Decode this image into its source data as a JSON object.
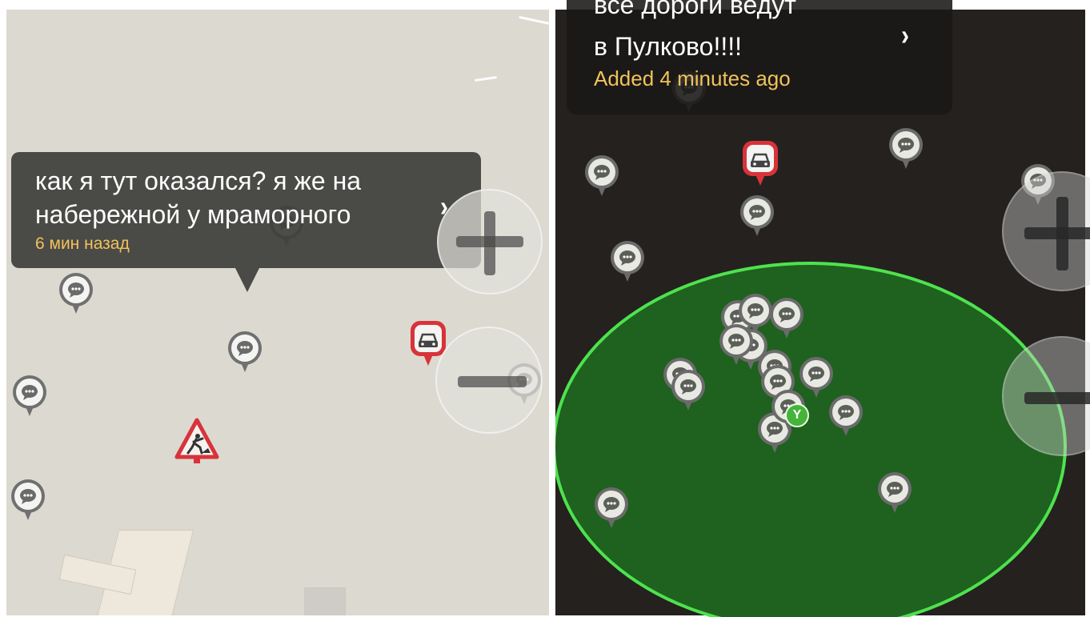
{
  "left_map": {
    "callout": {
      "line1": "как я тут оказался? я же на",
      "line2": "набережной у мраморного",
      "time": "6 мин назад",
      "chevron": "›"
    },
    "zoom_in_icon": "plus-icon",
    "zoom_out_icon": "minus-icon"
  },
  "right_map": {
    "callout": {
      "line1": "все дороги ведут",
      "line2": "в Пулково!!!!",
      "time": "Added 4 minutes ago",
      "chevron": "›"
    },
    "user_marker_label": "Y",
    "zoom_in_icon": "plus-icon",
    "zoom_out_icon": "minus-icon"
  },
  "colors": {
    "left_background": "#dcd9d0",
    "right_background": "#24211f",
    "callout_time": "#f2c25b",
    "radius_fill": "#1f611f",
    "radius_stroke": "#4ee24e",
    "alert_red": "#d8333a"
  },
  "icons": {
    "chat_marker": "chat-bubble-icon",
    "accident_marker": "car-accident-icon",
    "roadworks_marker": "roadworks-icon",
    "user_marker": "user-location-icon"
  }
}
